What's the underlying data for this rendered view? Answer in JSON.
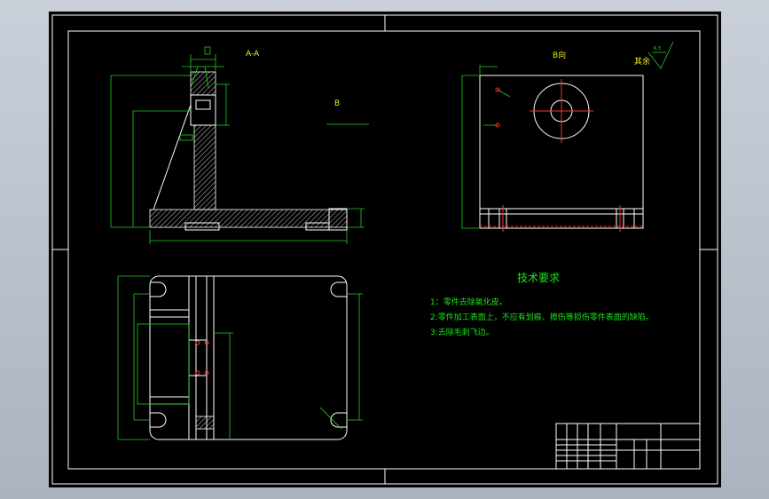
{
  "views": {
    "section_label": "A-A",
    "side_label": "B",
    "b_view_label": "B向"
  },
  "surface_finish": {
    "prefix": "其余",
    "value": "6.3"
  },
  "technical_requirements": {
    "title": "技术要求",
    "items": [
      "1：零件去除氧化皮。",
      "2:零件加工表面上，不应有划痕、擦伤等损伤零件表面的缺陷。",
      "3:去除毛刺飞边。"
    ]
  },
  "colors": {
    "background": "#000000",
    "outline": "#ffffff",
    "dimension": "#20d020",
    "center": "#ff3030",
    "label": "#e8e820"
  }
}
